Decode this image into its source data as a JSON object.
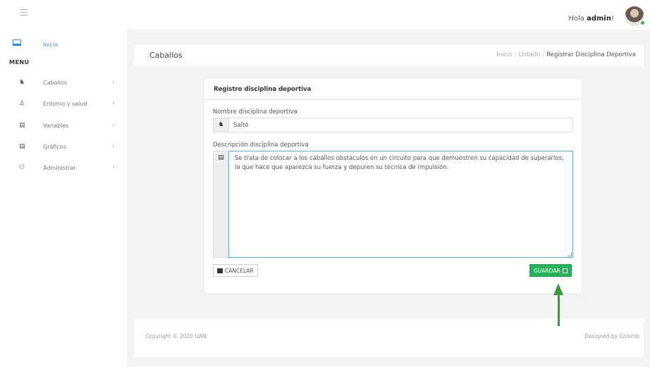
{
  "header": {
    "greeting": "Hola",
    "username": "admin",
    "greeting_suffix": "!"
  },
  "sidebar": {
    "home_label": "Inicio",
    "menu_title": "MENÚ",
    "items": [
      {
        "label": "Caballos",
        "icon": "horse-icon"
      },
      {
        "label": "Entorno y salud",
        "icon": "user-icon"
      },
      {
        "label": "Variables",
        "icon": "file-icon"
      },
      {
        "label": "Gráficos",
        "icon": "chart-icon"
      },
      {
        "label": "Administrar",
        "icon": "users-icon"
      }
    ]
  },
  "page": {
    "title": "Caballos",
    "breadcrumb": [
      "Inicio",
      "Listado",
      "Registrar Disciplina Deportiva"
    ]
  },
  "form": {
    "title": "Registro disciplina deportiva",
    "name_label": "Nombre disciplina deportiva",
    "name_value": "Salto",
    "desc_label": "Descripción disciplina deportiva",
    "desc_value": "Se trata de colocar a los caballos obstáculos en un circuito para que demuestren su capacidad de superarlos, lo que hace que aparezca su fuerza y depuren su técnica de impulsión.",
    "cancel_label": "CANCELAR",
    "save_label": "GUARDAR"
  },
  "footer": {
    "copyright": "Copyright © 2020 UAN",
    "designed_by": "Designed by Colorlib"
  },
  "colors": {
    "accent": "#2a8be0",
    "save": "#26b25a",
    "annotation_arrow": "#3d9a3a"
  }
}
